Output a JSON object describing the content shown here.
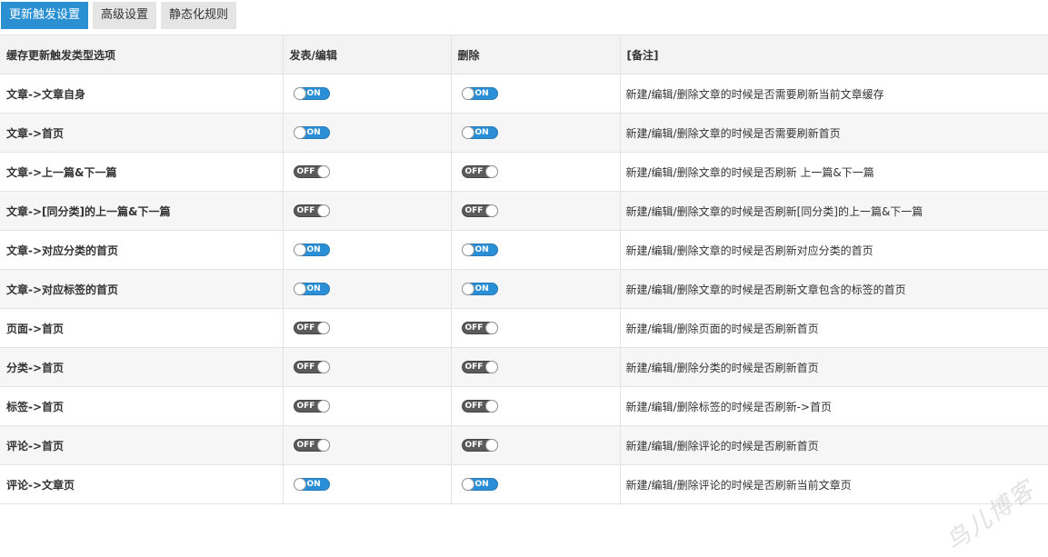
{
  "tabs": [
    {
      "label": "更新触发设置",
      "active": true
    },
    {
      "label": "高级设置",
      "active": false
    },
    {
      "label": "静态化规则",
      "active": false
    }
  ],
  "table": {
    "headers": [
      "缓存更新触发类型选项",
      "发表/编辑",
      "删除",
      "[备注]"
    ],
    "switch_on_label": "ON",
    "switch_off_label": "OFF",
    "rows": [
      {
        "label": "文章->文章自身",
        "publish": true,
        "delete": true,
        "note": "新建/编辑/删除文章的时候是否需要刷新当前文章缓存"
      },
      {
        "label": "文章->首页",
        "publish": true,
        "delete": true,
        "note": "新建/编辑/删除文章的时候是否需要刷新首页"
      },
      {
        "label": "文章->上一篇&下一篇",
        "publish": false,
        "delete": false,
        "note": "新建/编辑/删除文章的时候是否刷新 上一篇&下一篇"
      },
      {
        "label": "文章->[同分类]的上一篇&下一篇",
        "publish": false,
        "delete": false,
        "note": "新建/编辑/删除文章的时候是否刷新[同分类]的上一篇&下一篇"
      },
      {
        "label": "文章->对应分类的首页",
        "publish": true,
        "delete": true,
        "note": "新建/编辑/删除文章的时候是否刷新对应分类的首页"
      },
      {
        "label": "文章->对应标签的首页",
        "publish": true,
        "delete": true,
        "note": "新建/编辑/删除文章的时候是否刷新文章包含的标签的首页"
      },
      {
        "label": "页面->首页",
        "publish": false,
        "delete": false,
        "note": "新建/编辑/删除页面的时候是否刷新首页"
      },
      {
        "label": "分类->首页",
        "publish": false,
        "delete": false,
        "note": "新建/编辑/删除分类的时候是否刷新首页"
      },
      {
        "label": "标签->首页",
        "publish": false,
        "delete": false,
        "note": "新建/编辑/删除标签的时候是否刷新->首页"
      },
      {
        "label": "评论->首页",
        "publish": false,
        "delete": false,
        "note": "新建/编辑/删除评论的时候是否刷新首页"
      },
      {
        "label": "评论->文章页",
        "publish": true,
        "delete": true,
        "note": "新建/编辑/删除评论的时候是否刷新当前文章页"
      }
    ]
  },
  "watermark": "鸟儿博客",
  "colors": {
    "accent": "#2a90d2",
    "switch_on": "#2a8fd6",
    "switch_off": "#5b5b5b"
  }
}
